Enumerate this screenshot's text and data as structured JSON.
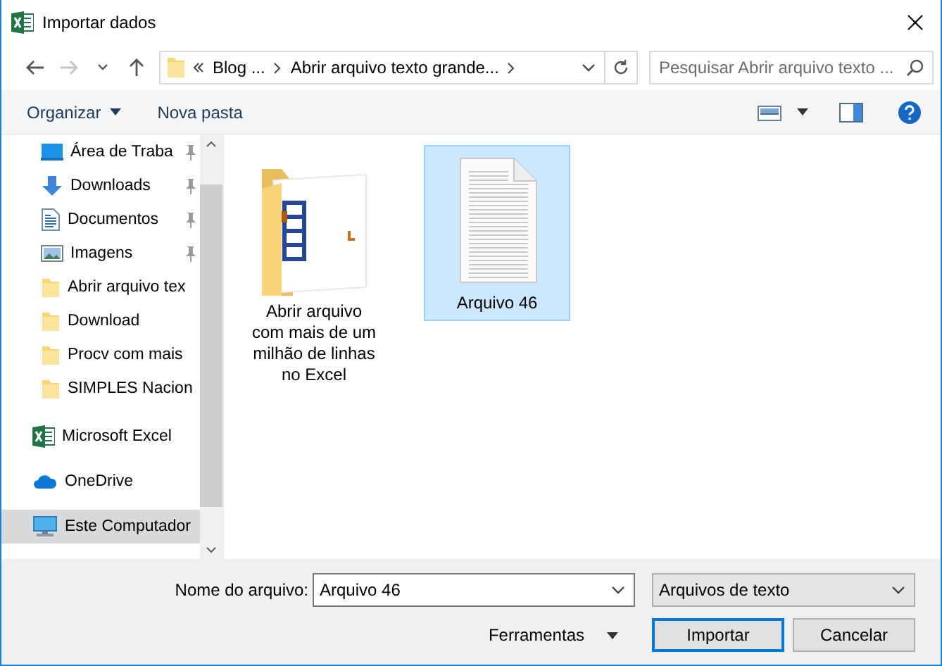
{
  "window": {
    "title": "Importar dados"
  },
  "address": {
    "crumbs": [
      {
        "label": "Blog ..."
      },
      {
        "label": "Abrir arquivo texto grande..."
      }
    ]
  },
  "search": {
    "placeholder": "Pesquisar Abrir arquivo texto ..."
  },
  "toolbar": {
    "organize": "Organizar",
    "new_folder": "Nova pasta"
  },
  "sidebar": {
    "quick_access": [
      {
        "label": "Área de Traba",
        "kind": "desktop",
        "pinned": true,
        "selected": false
      },
      {
        "label": "Downloads",
        "kind": "download",
        "pinned": true,
        "selected": false
      },
      {
        "label": "Documentos",
        "kind": "documents",
        "pinned": true,
        "selected": false
      },
      {
        "label": "Imagens",
        "kind": "pictures",
        "pinned": true,
        "selected": false
      },
      {
        "label": "Abrir arquivo tex",
        "kind": "folder",
        "pinned": false,
        "selected": false
      },
      {
        "label": "Download",
        "kind": "folder",
        "pinned": false,
        "selected": false
      },
      {
        "label": "Procv com mais",
        "kind": "folder",
        "pinned": false,
        "selected": false
      },
      {
        "label": "SIMPLES Nacion",
        "kind": "folder",
        "pinned": false,
        "selected": false
      }
    ],
    "locations": [
      {
        "label": "Microsoft Excel",
        "kind": "excel",
        "selected": false
      },
      {
        "label": "OneDrive",
        "kind": "onedrive",
        "selected": false
      },
      {
        "label": "Este Computador",
        "kind": "computer",
        "selected": true
      }
    ]
  },
  "files": [
    {
      "name": "Abrir arquivo com mais de um milhão de linhas no Excel",
      "kind": "folder",
      "selected": false
    },
    {
      "name": "Arquivo 46",
      "kind": "text",
      "selected": true
    }
  ],
  "footer": {
    "filename_label": "Nome do arquivo:",
    "filename": "Arquivo 46",
    "filetype": "Arquivos de texto",
    "tools": "Ferramentas",
    "import": "Importar",
    "cancel": "Cancelar"
  }
}
